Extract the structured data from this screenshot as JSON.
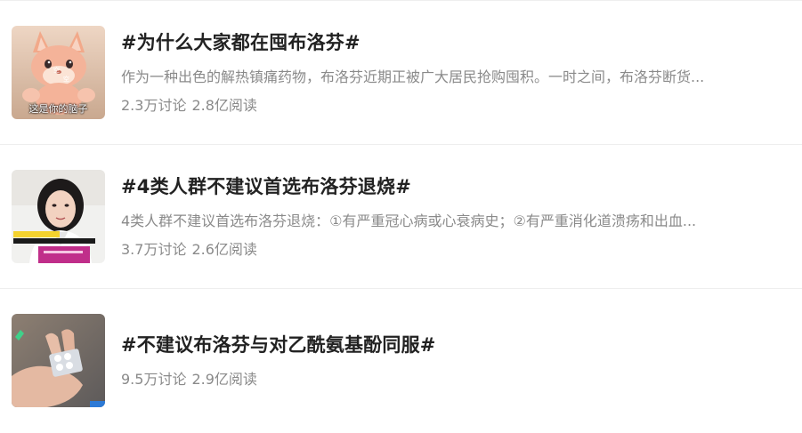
{
  "topics": [
    {
      "title": "#为什么大家都在囤布洛芬#",
      "description": "作为一种出色的解热镇痛药物，布洛芬近期正被广大居民抢购囤积。一时之间，布洛芬断货...",
      "discussions": "2.3万讨论",
      "reads": "2.8亿阅读",
      "thumbnail": {
        "icon": "cartoon-fox-icon",
        "caption": "这是你的脑子"
      }
    },
    {
      "title": "#4类人群不建议首选布洛芬退烧#",
      "description": "4类人群不建议首选布洛芬退烧：①有严重冠心病或心衰病史；②有严重消化道溃疡和出血...",
      "discussions": "3.7万讨论",
      "reads": "2.6亿阅读",
      "thumbnail": {
        "icon": "doctor-video-icon"
      }
    },
    {
      "title": "#不建议布洛芬与对乙酰氨基酚同服#",
      "description": "",
      "discussions": "9.5万讨论",
      "reads": "2.9亿阅读",
      "thumbnail": {
        "icon": "pill-blister-pack-icon"
      }
    }
  ]
}
